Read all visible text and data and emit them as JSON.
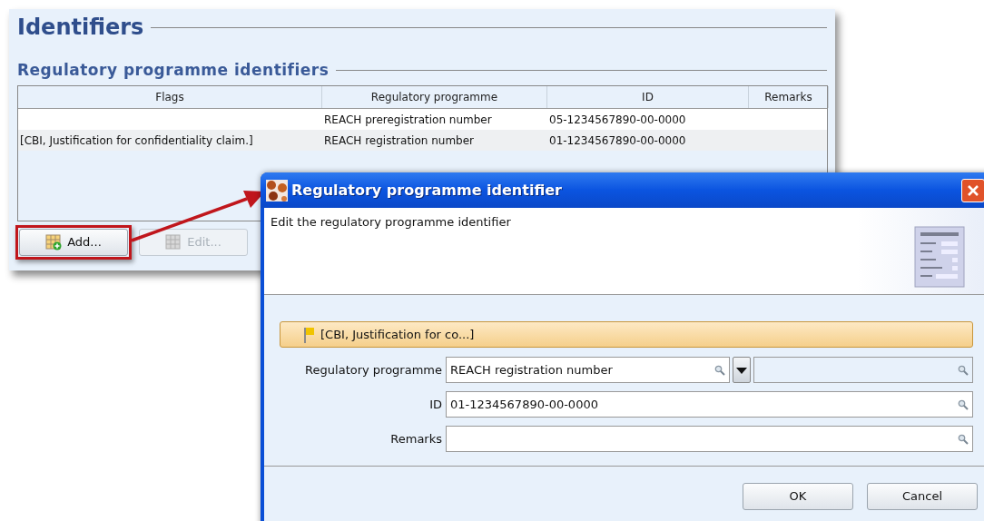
{
  "panel": {
    "title": "Identifiers",
    "section_title": "Regulatory programme identifiers",
    "table": {
      "columns": [
        "Flags",
        "Regulatory programme",
        "ID",
        "Remarks"
      ],
      "rows": [
        {
          "programme": "REACH preregistration number",
          "id": "05-1234567890-00-0000"
        },
        {
          "flags": "[CBI, Justification for confidentiality claim.]",
          "programme": "REACH registration number",
          "id": "01-1234567890-00-0000"
        }
      ]
    },
    "buttons": [
      {
        "label": "Add...",
        "disabled": false,
        "highlighted": true
      },
      {
        "label": "Edit...",
        "disabled": true,
        "highlighted": false
      }
    ]
  },
  "dialog": {
    "title": "Regulatory programme identifier",
    "description": "Edit the regulatory programme identifier",
    "flag_bar": "[CBI, Justification for co...]",
    "fields": [
      {
        "kind": "combo",
        "label": "Regulatory programme",
        "value": "REACH registration number"
      },
      {
        "kind": "text",
        "label": "ID",
        "value": "01-1234567890-00-0000"
      },
      {
        "kind": "text",
        "label": "Remarks"
      }
    ],
    "buttons": [
      "OK",
      "Cancel"
    ]
  }
}
